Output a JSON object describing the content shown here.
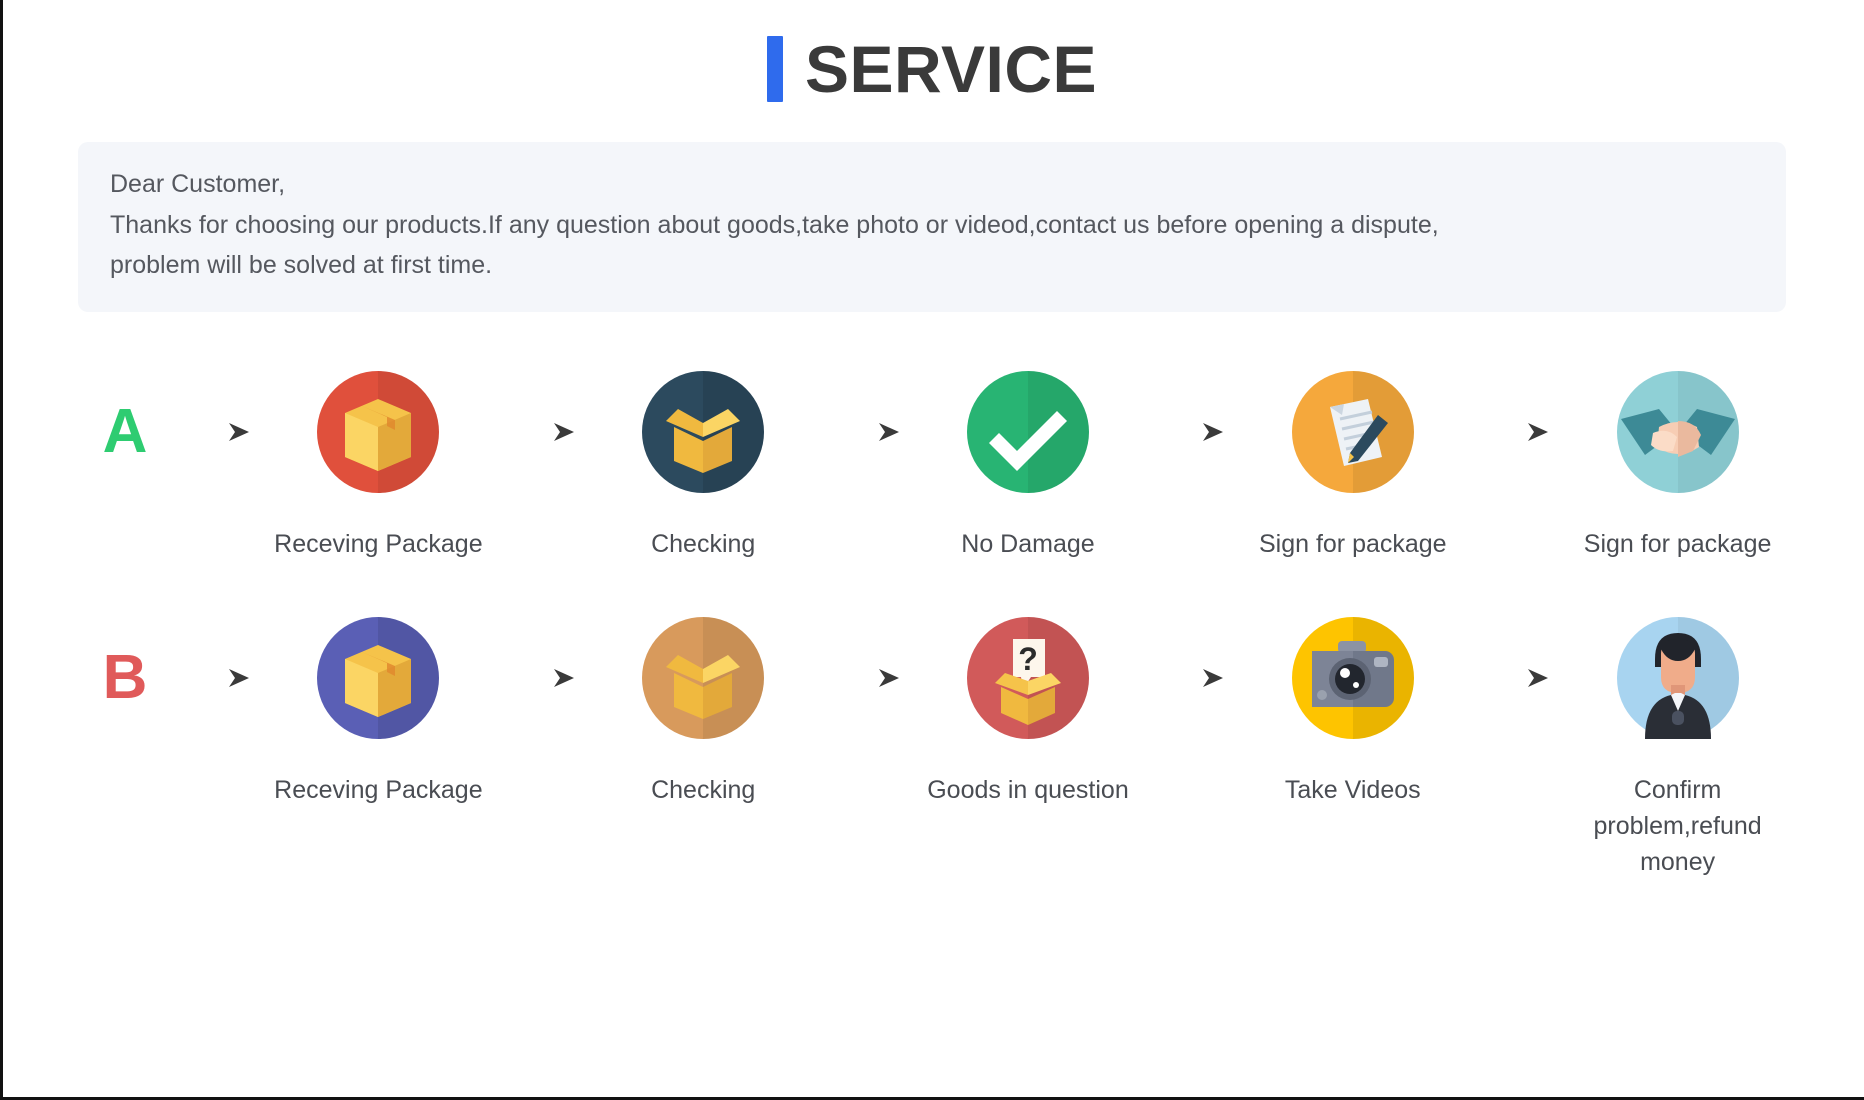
{
  "header": {
    "accent_bar_color": "#2f6bed",
    "title": "SERVICE"
  },
  "notice": {
    "background_color": "#f4f6fa",
    "line1": "Dear Customer,",
    "line2": "Thanks for choosing our products.If any question about goods,take photo or videod,contact us before opening a dispute,",
    "line3": "problem will be solved at first time."
  },
  "flows": [
    {
      "letter": "A",
      "letter_color": "#2ecc71",
      "steps": [
        {
          "label": "Receving Package",
          "icon": "package-box-icon",
          "circle_color": "#e0503c"
        },
        {
          "label": "Checking",
          "icon": "open-box-icon",
          "circle_color": "#2c4a5e"
        },
        {
          "label": "No Damage",
          "icon": "check-mark-icon",
          "circle_color": "#28b473"
        },
        {
          "label": "Sign for package",
          "icon": "document-pen-icon",
          "circle_color": "#f5a83c"
        },
        {
          "label": "Sign for package",
          "icon": "handshake-icon",
          "circle_color": "#8fd0d6"
        }
      ]
    },
    {
      "letter": "B",
      "letter_color": "#e05a5a",
      "steps": [
        {
          "label": "Receving Package",
          "icon": "package-box-icon",
          "circle_color": "#5a5fb5"
        },
        {
          "label": "Checking",
          "icon": "open-box-icon",
          "circle_color": "#d89a5c"
        },
        {
          "label": "Goods in question",
          "icon": "question-box-icon",
          "circle_color": "#d15a5a"
        },
        {
          "label": "Take Videos",
          "icon": "camera-icon",
          "circle_color": "#fec400"
        },
        {
          "label": "Confirm problem,refund money",
          "icon": "support-agent-icon",
          "circle_color": "#a8d4f0"
        }
      ]
    }
  ],
  "arrow": {
    "name": "right-arrow-icon",
    "color": "#3d3d3d"
  }
}
